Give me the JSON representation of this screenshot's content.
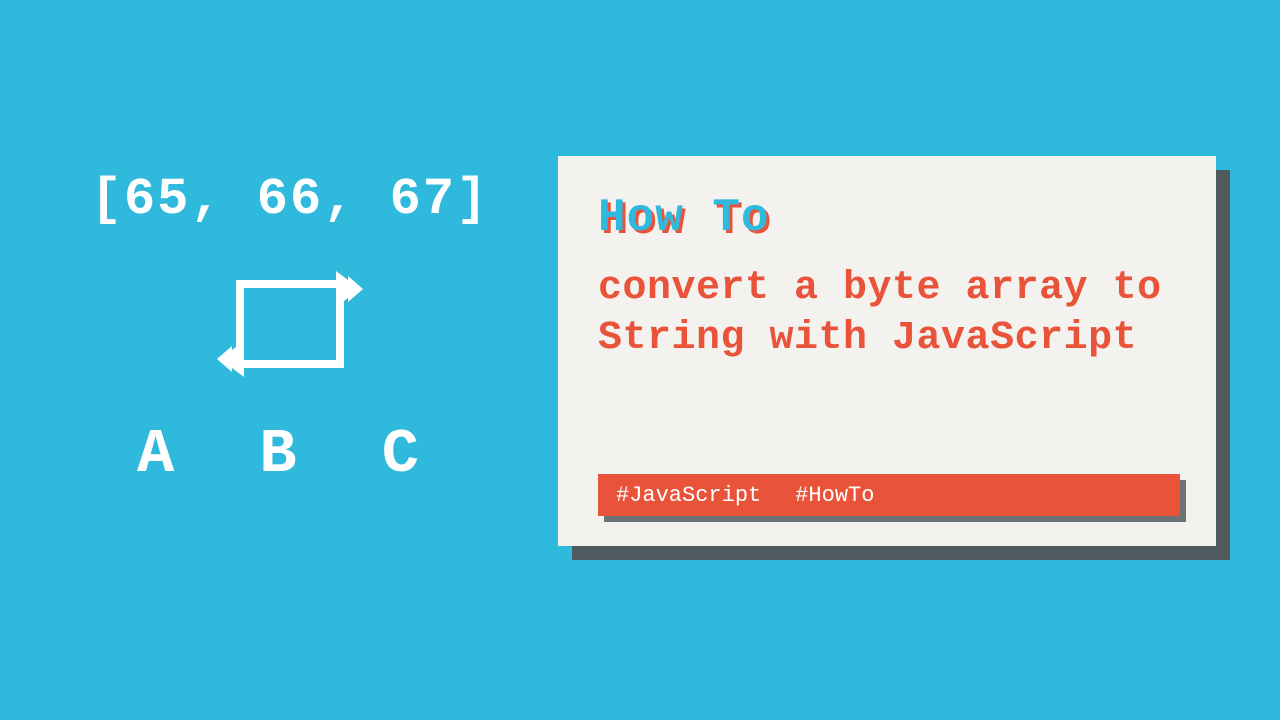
{
  "left": {
    "byte_array": "[65, 66, 67]",
    "result": "A B C"
  },
  "card": {
    "kicker": "How To",
    "title": "convert a byte array to String with JavaScript",
    "tags": [
      "#JavaScript",
      "#HowTo"
    ]
  },
  "colors": {
    "bg": "#2fb9dd",
    "accent": "#e8533a",
    "card_bg": "#f4f2ee",
    "shadow": "#4e5a5e"
  }
}
